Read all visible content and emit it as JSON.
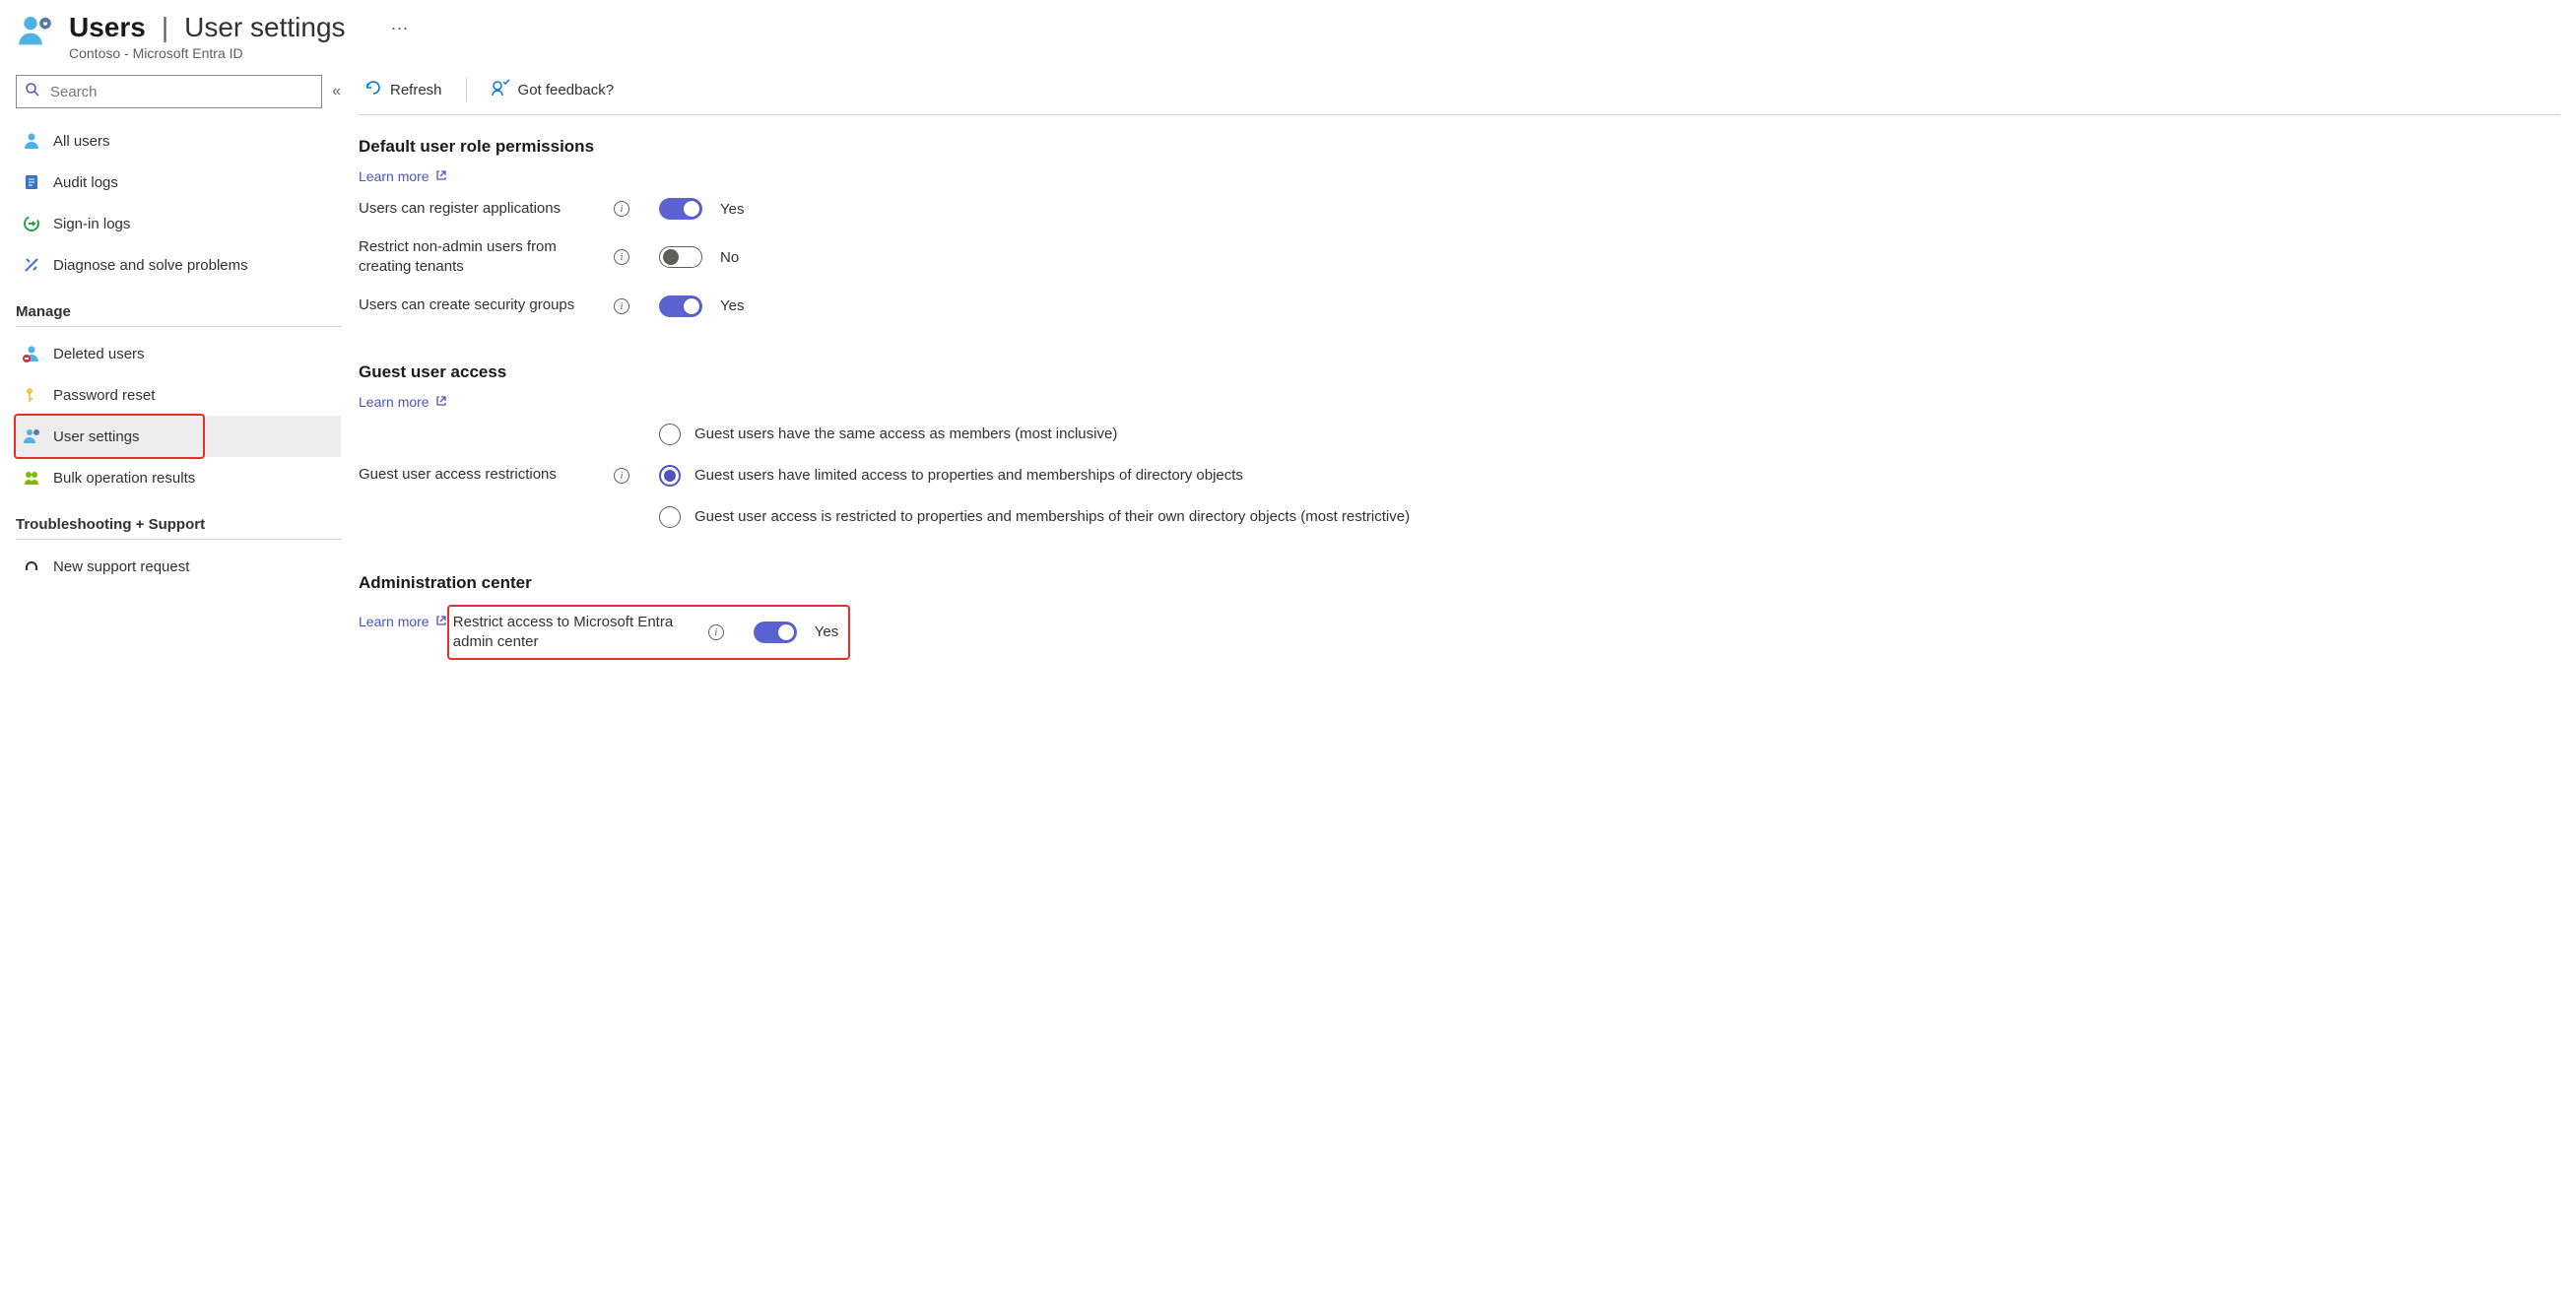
{
  "header": {
    "title_main": "Users",
    "title_sub": "User settings",
    "subtitle": "Contoso - Microsoft Entra ID",
    "ellipsis": "···"
  },
  "sidebar": {
    "search_placeholder": "Search",
    "items_top": [
      {
        "label": "All users"
      },
      {
        "label": "Audit logs"
      },
      {
        "label": "Sign-in logs"
      },
      {
        "label": "Diagnose and solve problems"
      }
    ],
    "group_manage": "Manage",
    "items_manage": [
      {
        "label": "Deleted users"
      },
      {
        "label": "Password reset"
      },
      {
        "label": "User settings"
      },
      {
        "label": "Bulk operation results"
      }
    ],
    "group_support": "Troubleshooting + Support",
    "items_support": [
      {
        "label": "New support request"
      }
    ]
  },
  "toolbar": {
    "refresh": "Refresh",
    "feedback": "Got feedback?"
  },
  "sections": {
    "default_perms": {
      "title": "Default user role permissions",
      "learn_more": "Learn more",
      "rows": [
        {
          "label": "Users can register applications",
          "value": "Yes",
          "on": true
        },
        {
          "label": "Restrict non-admin users from creating tenants",
          "value": "No",
          "on": false
        },
        {
          "label": "Users can create security groups",
          "value": "Yes",
          "on": true
        }
      ]
    },
    "guest": {
      "title": "Guest user access",
      "learn_more": "Learn more",
      "row_label": "Guest user access restrictions",
      "options": [
        "Guest users have the same access as members (most inclusive)",
        "Guest users have limited access to properties and memberships of directory objects",
        "Guest user access is restricted to properties and memberships of their own directory objects (most restrictive)"
      ],
      "selected": 1
    },
    "admin": {
      "title": "Administration center",
      "learn_more": "Learn more",
      "row_label": "Restrict access to Microsoft Entra admin center",
      "value": "Yes",
      "on": true
    }
  }
}
